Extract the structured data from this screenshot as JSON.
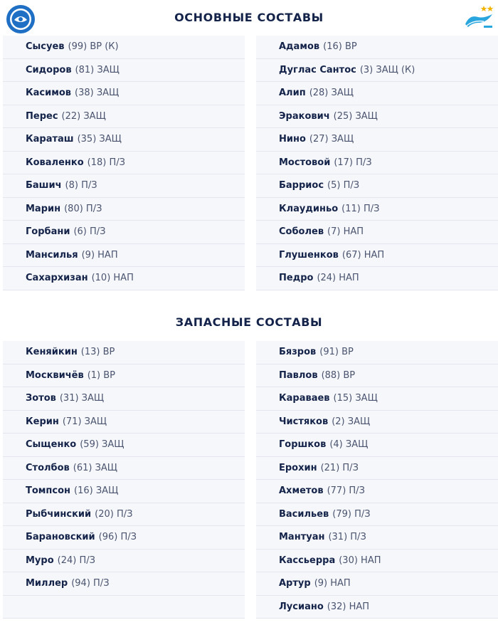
{
  "starting": {
    "title": "ОСНОВНЫЕ СОСТАВЫ",
    "left": [
      {
        "name": "Сысуев",
        "meta": "(99) ВР (К)"
      },
      {
        "name": "Сидоров",
        "meta": "(81) ЗАЩ"
      },
      {
        "name": "Касимов",
        "meta": "(38) ЗАЩ"
      },
      {
        "name": "Перес",
        "meta": "(22) ЗАЩ"
      },
      {
        "name": "Караташ",
        "meta": "(35) ЗАЩ"
      },
      {
        "name": "Коваленко",
        "meta": "(18) П/З"
      },
      {
        "name": "Башич",
        "meta": "(8) П/З"
      },
      {
        "name": "Марин",
        "meta": "(80) П/З"
      },
      {
        "name": "Горбани",
        "meta": "(6) П/З"
      },
      {
        "name": "Мансилья",
        "meta": "(9) НАП"
      },
      {
        "name": "Сахархизан",
        "meta": "(10) НАП"
      }
    ],
    "right": [
      {
        "name": "Адамов",
        "meta": "(16) ВР"
      },
      {
        "name": "Дуглас Сантос",
        "meta": "(3) ЗАЩ (К)"
      },
      {
        "name": "Алип",
        "meta": "(28) ЗАЩ"
      },
      {
        "name": "Эракович",
        "meta": "(25) ЗАЩ"
      },
      {
        "name": "Нино",
        "meta": "(27) ЗАЩ"
      },
      {
        "name": "Мостовой",
        "meta": "(17) П/З"
      },
      {
        "name": "Барриос",
        "meta": "(5) П/З"
      },
      {
        "name": "Клаудиньо",
        "meta": "(11) П/З"
      },
      {
        "name": "Соболев",
        "meta": "(7) НАП"
      },
      {
        "name": "Глушенков",
        "meta": "(67) НАП"
      },
      {
        "name": "Педро",
        "meta": "(24) НАП"
      }
    ]
  },
  "reserves": {
    "title": "ЗАПАСНЫЕ СОСТАВЫ",
    "left": [
      {
        "name": "Кеняйкин",
        "meta": "(13) ВР"
      },
      {
        "name": "Москвичёв",
        "meta": "(1) ВР"
      },
      {
        "name": "Зотов",
        "meta": "(31) ЗАЩ"
      },
      {
        "name": "Керин",
        "meta": "(71) ЗАЩ"
      },
      {
        "name": "Сыщенко",
        "meta": "(59) ЗАЩ"
      },
      {
        "name": "Столбов",
        "meta": "(61) ЗАЩ"
      },
      {
        "name": "Томпсон",
        "meta": "(16) ЗАЩ"
      },
      {
        "name": "Рыбчинский",
        "meta": "(20) П/З"
      },
      {
        "name": "Барановский",
        "meta": "(96) П/З"
      },
      {
        "name": "Муро",
        "meta": "(24) П/З"
      },
      {
        "name": "Миллер",
        "meta": "(94) П/З"
      }
    ],
    "right": [
      {
        "name": "Бязров",
        "meta": "(91) ВР"
      },
      {
        "name": "Павлов",
        "meta": "(88) ВР"
      },
      {
        "name": "Караваев",
        "meta": "(15) ЗАЩ"
      },
      {
        "name": "Чистяков",
        "meta": "(2) ЗАЩ"
      },
      {
        "name": "Горшков",
        "meta": "(4) ЗАЩ"
      },
      {
        "name": "Ерохин",
        "meta": "(21) П/З"
      },
      {
        "name": "Ахметов",
        "meta": "(77) П/З"
      },
      {
        "name": "Васильев",
        "meta": "(79) П/З"
      },
      {
        "name": "Мантуан",
        "meta": "(31) П/З"
      },
      {
        "name": "Кассьерра",
        "meta": "(30) НАП"
      },
      {
        "name": "Артур",
        "meta": "(9) НАП"
      },
      {
        "name": "Лусиано",
        "meta": "(32) НАП"
      }
    ]
  },
  "logos": {
    "left": "orenburg-club-logo-icon",
    "right": "zenit-club-logo-icon"
  },
  "colors": {
    "text": "#14234a",
    "meta": "#4a5470",
    "row_bg": "#f6f7fa",
    "row_border": "#e3e6ee",
    "orenburg_blue": "#1f6fc4",
    "zenit_blue": "#2aa6df"
  }
}
